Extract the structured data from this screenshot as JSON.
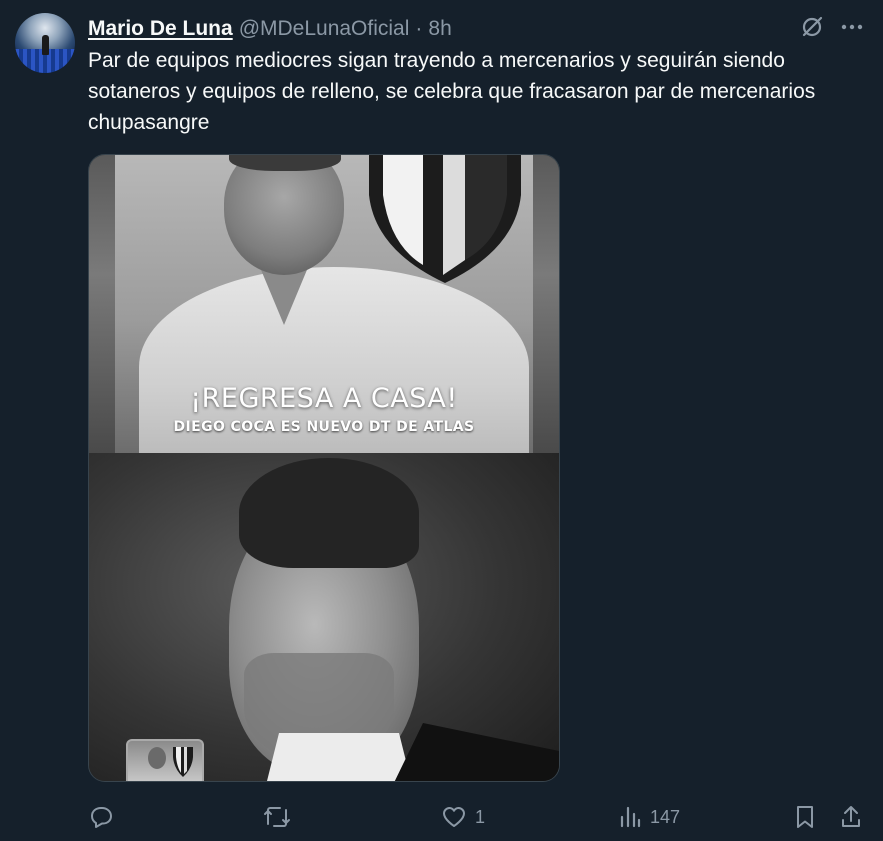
{
  "tweet": {
    "author": {
      "display_name": "Mario De Luna",
      "handle": "@MDeLunaOficial",
      "avatar_icon": "avatar-stadium"
    },
    "separator": "·",
    "time": "8h",
    "text": "Par de equipos mediocres sigan trayendo a mercenarios y seguirán siendo sotaneros y equipos de relleno, se celebra que fracasaron par de mercenarios chupasangre",
    "top_actions": {
      "grok_icon": "grok-icon",
      "more_icon": "more-icon"
    },
    "media": {
      "headline": "¡REGRESA A CASA!",
      "subheadline": "DIEGO COCA ES NUEVO DT DE ATLAS",
      "logo_icon": "atlas-shield-icon"
    },
    "actions": {
      "reply": {
        "icon": "reply-icon",
        "count": ""
      },
      "retweet": {
        "icon": "retweet-icon",
        "count": ""
      },
      "like": {
        "icon": "heart-icon",
        "count": "1"
      },
      "views": {
        "icon": "views-icon",
        "count": "147"
      },
      "bookmark": {
        "icon": "bookmark-icon"
      },
      "share": {
        "icon": "share-icon"
      }
    }
  },
  "colors": {
    "background": "#15202b",
    "text_primary": "#f7f9f9",
    "text_secondary": "#8b98a5",
    "border": "#38444d"
  }
}
